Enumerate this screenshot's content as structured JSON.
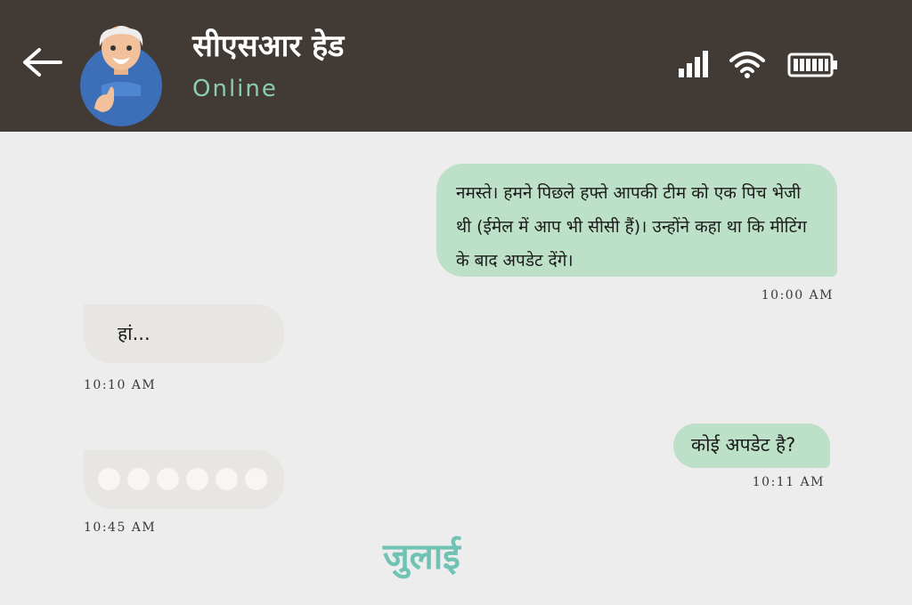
{
  "header": {
    "back_icon": "arrow-left-icon",
    "contact_name": "सीएसआर हेड",
    "status": "Online",
    "avatar": "avatar-thumbs-up-old-man",
    "status_icons": [
      "signal-icon",
      "wifi-icon",
      "battery-icon"
    ],
    "colors": {
      "background": "#413a35",
      "status_text": "#8ccdb2"
    }
  },
  "messages": [
    {
      "direction": "outgoing",
      "text": "नमस्ते। हमने पिछले हफ्ते आपकी टीम को एक पिच भेजी थी (ईमेल में आप भी सीसी हैं)। उन्होंने कहा था कि मीटिंग के बाद अपडेट देंगे।",
      "time": "10:00 AM"
    },
    {
      "direction": "incoming",
      "text": "हां...",
      "time": "10:10 AM"
    },
    {
      "direction": "outgoing",
      "text": "कोई अपडेट है?",
      "time": "10:11 AM"
    },
    {
      "direction": "incoming",
      "typing_indicator_dots": 6,
      "time": "10:45 AM"
    }
  ],
  "footer_label": "जुलाई",
  "colors": {
    "outgoing_bubble": "#bde0c8",
    "incoming_bubble": "#e8e6e2",
    "chat_background": "#ededed",
    "footer_label": "#6fc2b4"
  }
}
